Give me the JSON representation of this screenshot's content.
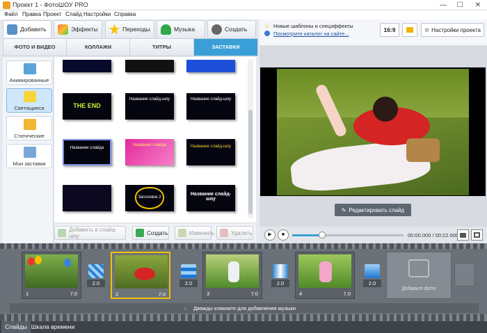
{
  "window": {
    "title": "Проект 1 - ФотоШОУ PRO",
    "min": "—",
    "max": "☐",
    "close": "✕"
  },
  "menu": [
    "Файл",
    "Правка",
    "Проект",
    "Слайд",
    "Настройки",
    "Справка"
  ],
  "main_tabs": [
    "Добавить",
    "Эффекты",
    "Переходы",
    "Музыка",
    "Создать"
  ],
  "sub_tabs": [
    "ФОТО И ВИДЕО",
    "КОЛЛАЖИ",
    "ТИТРЫ",
    "ЗАСТАВКИ"
  ],
  "categories": [
    "Анимированные",
    "Светящиеся",
    "Статические",
    "Мои заставки"
  ],
  "thumbnails": [
    {
      "text": ""
    },
    {
      "text": ""
    },
    {
      "text": ""
    },
    {
      "text": "THE END"
    },
    {
      "text": "Название слайд-шоу"
    },
    {
      "text": "Название слайд-шоу"
    },
    {
      "text": "Название слайда"
    },
    {
      "text": "Название слайда"
    },
    {
      "text": "Название слайд-шоу"
    },
    {
      "text": ""
    },
    {
      "text": "Заголовок 2"
    },
    {
      "text": "Название слайд-шоу"
    }
  ],
  "actions": {
    "add": "Добавить в слайд-шоу",
    "create": "Создать",
    "edit": "Изменить",
    "delete": "Удалить"
  },
  "top_right": {
    "new_templates": "Новые шаблоны и спецэффекты",
    "catalog_link": "Посмотрите каталог на сайте...",
    "aspect": "16:9",
    "settings": "Настройки проекта"
  },
  "preview": {
    "edit_button": "Редактировать слайд",
    "time": "00:00.000 / 00:22.000",
    "progress": 0.27
  },
  "timeline": {
    "slides": [
      {
        "num": "1",
        "duration": "7.0"
      },
      {
        "num": "2",
        "duration": "7.0"
      },
      {
        "num": "3",
        "duration": "7.0"
      },
      {
        "num": "4",
        "duration": "7.0"
      }
    ],
    "transitions": [
      "2.0",
      "2.0",
      "2.0",
      "2.0"
    ],
    "add_photo": "Добавьте фото",
    "music_hint": "Дважды кликните для добавления музыки"
  },
  "bottom_tabs": [
    "Слайды",
    "Шкала времени"
  ],
  "colors": {
    "accent": "#3a9fd6",
    "active_slide": "#f2c200"
  }
}
